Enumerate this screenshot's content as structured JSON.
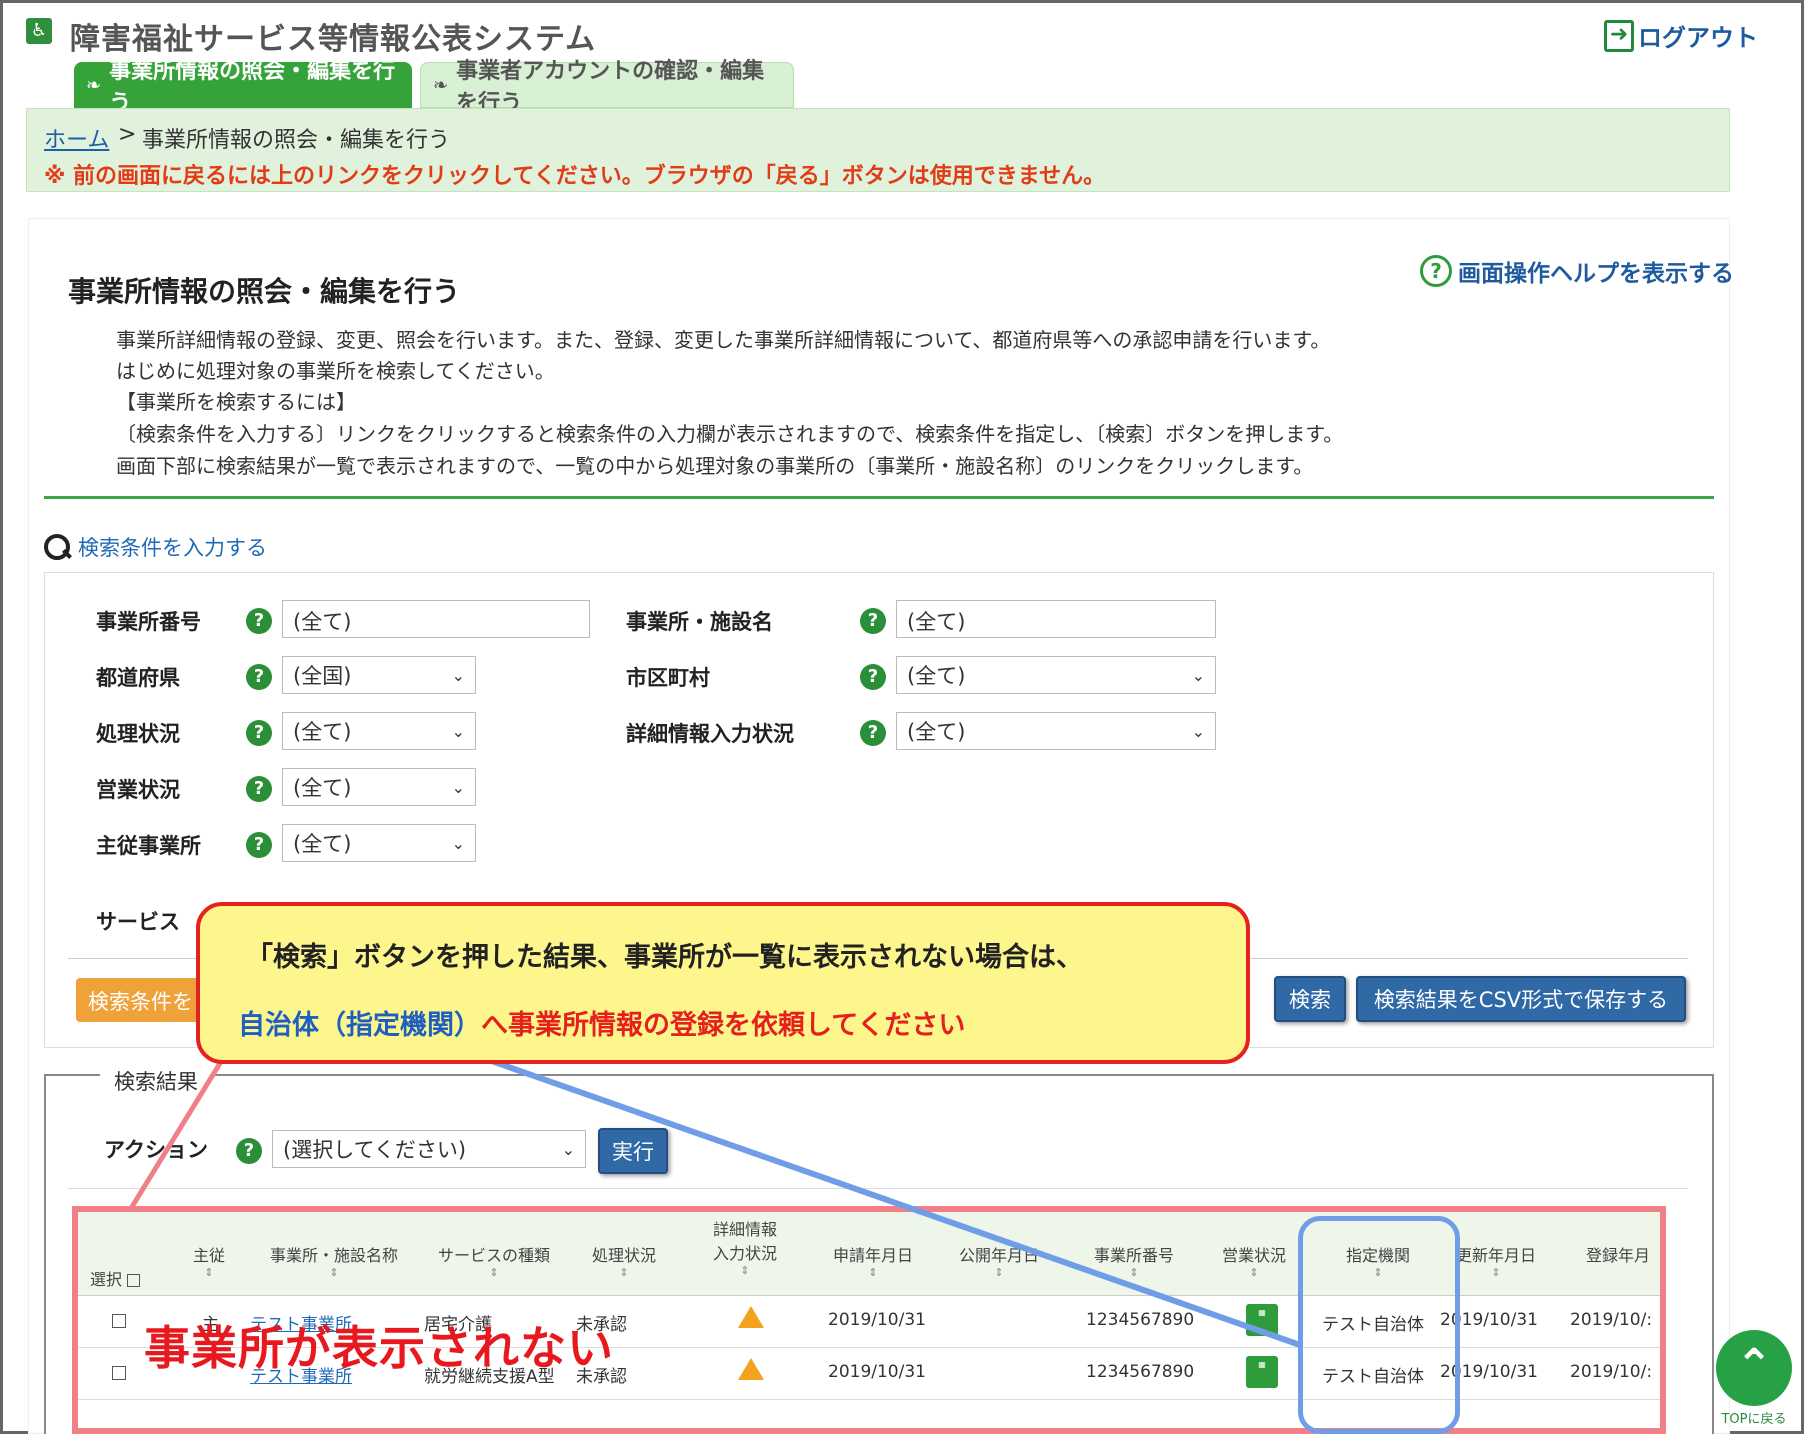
{
  "header": {
    "title": "障害福祉サービス等情報公表システム",
    "logout": "ログアウト"
  },
  "tabs": [
    {
      "label": "事業所情報の照会・編集を行う"
    },
    {
      "label": "事業者アカウントの確認・編集を行う"
    }
  ],
  "breadcrumb": {
    "home": "ホーム",
    "sep": ">",
    "current": "事業所情報の照会・編集を行う",
    "warning": "※ 前の画面に戻るには上のリンクをクリックしてください。ブラウザの「戻る」ボタンは使用できません。"
  },
  "page": {
    "help_link": "画面操作ヘルプを表示する",
    "title": "事業所情報の照会・編集を行う",
    "desc": [
      "事業所詳細情報の登録、変更、照会を行います。また、登録、変更した事業所詳細情報について、都道府県等への承認申請を行います。",
      "はじめに処理対象の事業所を検索してください。",
      "【事業所を検索するには】",
      "〔検索条件を入力する〕リンクをクリックすると検索条件の入力欄が表示されますので、検索条件を指定し、〔検索〕ボタンを押します。",
      "画面下部に検索結果が一覧で表示されますので、一覧の中から処理対象の事業所の〔事業所・施設名称〕のリンクをクリックします。"
    ]
  },
  "search": {
    "toggle": "検索条件を入力する",
    "fields": {
      "office_no": {
        "label": "事業所番号",
        "value": "(全て)"
      },
      "office_name": {
        "label": "事業所・施設名",
        "value": "(全て)"
      },
      "prefecture": {
        "label": "都道府県",
        "value": "(全国)"
      },
      "city": {
        "label": "市区町村",
        "value": "(全て)"
      },
      "process_status": {
        "label": "処理状況",
        "value": "(全て)"
      },
      "detail_status": {
        "label": "詳細情報入力状況",
        "value": "(全て)"
      },
      "business_status": {
        "label": "営業状況",
        "value": "(全て)"
      },
      "main_office": {
        "label": "主従事業所",
        "value": "(全て)"
      },
      "service": {
        "label": "サービス"
      }
    },
    "clear_button": "検索条件を",
    "search_button": "検索",
    "csv_button": "検索結果をCSV形式で保存する"
  },
  "results": {
    "legend": "検索結果",
    "action_label": "アクション",
    "action_value": "(選択してください)",
    "run_button": "実行",
    "columns": {
      "select": "選択",
      "main": "主従",
      "name": "事業所・施設名称",
      "service": "サービスの種類",
      "process": "処理状況",
      "detail1": "詳細情報",
      "detail2": "入力状況",
      "applied": "申請年月日",
      "published": "公開年月日",
      "office_no": "事業所番号",
      "business": "営業状況",
      "agency": "指定機関",
      "updated": "更新年月日",
      "registered": "登録年月"
    },
    "rows": [
      {
        "main": "主",
        "name": "テスト事業所",
        "service": "居宅介護",
        "process": "未承認",
        "applied": "2019/10/31",
        "office_no": "1234567890",
        "agency": "テスト自治体",
        "updated": "2019/10/31",
        "registered": "2019/10/:"
      },
      {
        "main": "",
        "name": "テスト事業所",
        "service": "就労継続支援A型",
        "process": "未承認",
        "applied": "2019/10/31",
        "office_no": "1234567890",
        "agency": "テスト自治体",
        "updated": "2019/10/31",
        "registered": "2019/10/:"
      }
    ]
  },
  "annotation": {
    "callout_line1": "「検索」ボタンを押した結果、事業所が一覧に表示されない場合は、",
    "callout_line2_blue": "自治体（指定機関）",
    "callout_line2_red": "へ事業所情報の登録を依頼してください",
    "not_shown": "事業所が表示されない"
  },
  "top_button": "TOPに戻る",
  "colors": {
    "green_tab": "#36a33a",
    "link_blue": "#1f5fa8",
    "warning_red": "#e23c16",
    "callout_bg": "#fdf68c",
    "callout_border": "#e52220",
    "highlight_blue": "#6f9ee6"
  }
}
